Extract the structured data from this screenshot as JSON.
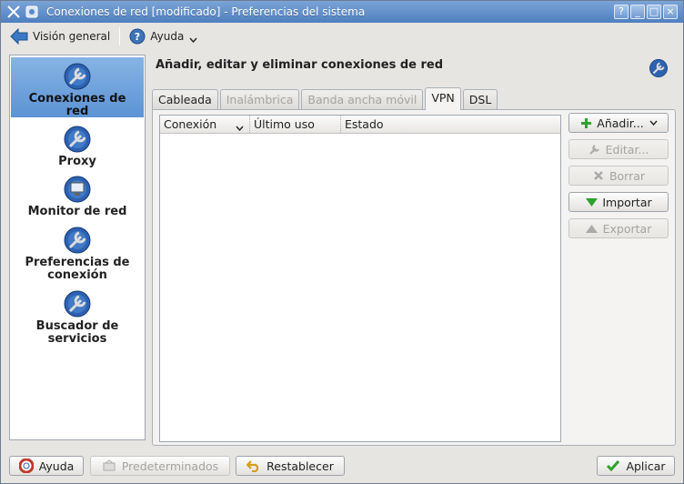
{
  "window": {
    "title": "Conexiones de red [modificado] - Preferencias del sistema",
    "buttons": [
      "?",
      "_",
      "□",
      "×"
    ]
  },
  "toolbar": {
    "overview_label": "Visión general",
    "help_label": "Ayuda"
  },
  "sidebar": {
    "items": [
      {
        "label": "Conexiones de red",
        "active": true,
        "icon": "network-wrench-icon"
      },
      {
        "label": "Proxy",
        "active": false,
        "icon": "network-wrench-icon"
      },
      {
        "label": "Monitor de red",
        "active": false,
        "icon": "network-monitor-icon"
      },
      {
        "label": "Preferencias de conexión",
        "active": false,
        "icon": "network-wrench-icon"
      },
      {
        "label": "Buscador de servicios",
        "active": false,
        "icon": "network-wrench-icon"
      }
    ]
  },
  "main": {
    "heading": "Añadir, editar y eliminar conexiones de red",
    "tabs": [
      {
        "label": "Cableada",
        "state": "normal"
      },
      {
        "label": "Inalámbrica",
        "state": "disabled"
      },
      {
        "label": "Banda ancha móvil",
        "state": "disabled"
      },
      {
        "label": "VPN",
        "state": "active"
      },
      {
        "label": "DSL",
        "state": "normal"
      }
    ],
    "table": {
      "columns": [
        "Conexión",
        "Último uso",
        "Estado"
      ],
      "rows": []
    },
    "buttons": {
      "add": "Añadir...",
      "edit": "Editar...",
      "delete": "Borrar",
      "import": "Importar",
      "export": "Exportar"
    }
  },
  "bottom": {
    "help": "Ayuda",
    "defaults": "Predeterminados",
    "reset": "Restablecer",
    "apply": "Aplicar"
  },
  "colors": {
    "titlebar": "#5b8ac8",
    "selection": "#6f9fd9",
    "add_green": "#2fa12f"
  }
}
